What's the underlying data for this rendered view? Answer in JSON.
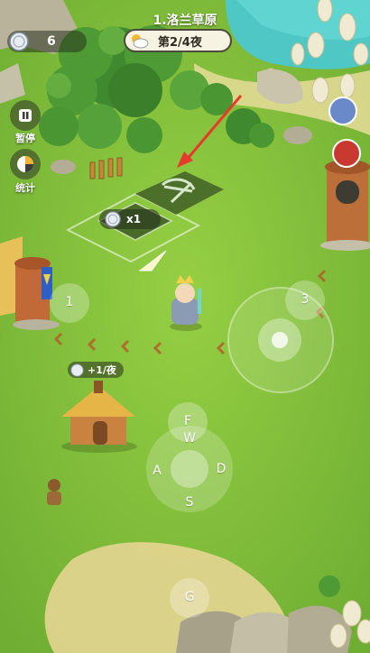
{
  "hud": {
    "coins": "6",
    "level_title": "1.洛兰草原",
    "night_label": "第2/4夜",
    "pause_label": "暂停",
    "stats_label": "统计"
  },
  "build_site": {
    "cost": "x1"
  },
  "hut": {
    "income": "+1/夜"
  },
  "markers": {
    "left": "1",
    "right": "3"
  },
  "dpad": {
    "up": "F",
    "top": "W",
    "left": "A",
    "right": "D",
    "down": "S",
    "extra": "G"
  },
  "colors": {
    "grass": "#84c23a",
    "arrow": "#e53b2c",
    "pill_bg": "#f7f3e2"
  },
  "icons": {
    "coin": "silver-coin-icon",
    "weather": "sun-cloud-icon",
    "pause": "pause-icon",
    "stats": "pie-chart-icon",
    "bow": "bow-icon"
  }
}
